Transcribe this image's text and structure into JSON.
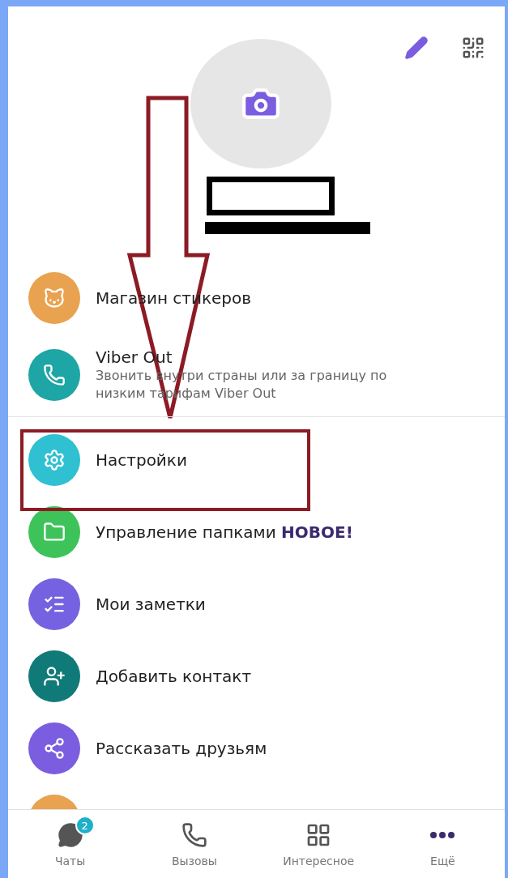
{
  "menu_groups": [
    [
      {
        "kind": "stickers",
        "color": "#e9a24f",
        "title": "Магазин стикеров"
      },
      {
        "kind": "call",
        "color": "#1ea5a5",
        "title": "Viber Out",
        "subtitle": "Звонить внутри страны или за границу по низким тарифам Viber Out"
      }
    ],
    [
      {
        "kind": "settings",
        "color": "#2fc0d2",
        "title": "Настройки"
      },
      {
        "kind": "folder",
        "color": "#3dc35a",
        "title": "Управление папками **НОВОЕ!**"
      },
      {
        "kind": "notes",
        "color": "#7462e0",
        "title": "Мои заметки"
      },
      {
        "kind": "contact",
        "color": "#107a78",
        "title": "Добавить контакт"
      },
      {
        "kind": "share",
        "color": "#7b5de0",
        "title": "Рассказать друзьям"
      },
      {
        "kind": "partial",
        "color": "#e9a24f"
      }
    ]
  ],
  "annotations": [
    {
      "kind": "redaction_box"
    },
    {
      "kind": "redaction_bar"
    },
    {
      "kind": "arrow"
    },
    {
      "kind": "highlight"
    }
  ],
  "bottom_nav": [
    {
      "kind": "chats",
      "label": "Чаты",
      "badge": "2",
      "selected": false
    },
    {
      "kind": "calls",
      "label": "Вызовы",
      "selected": false
    },
    {
      "kind": "explore",
      "label": "Интересное",
      "selected": false
    },
    {
      "kind": "more",
      "label": "Ещё",
      "selected": true
    }
  ]
}
